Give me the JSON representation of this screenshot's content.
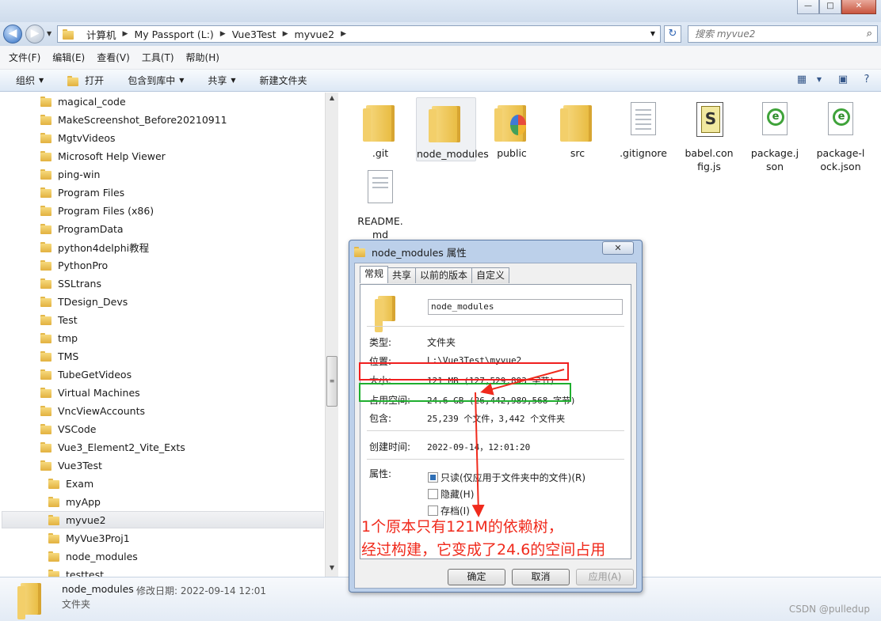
{
  "window": {
    "minimize_glyph": "—",
    "maximize_glyph": "□",
    "close_glyph": "✕"
  },
  "address": {
    "crumbs": [
      "计算机",
      "My Passport (L:)",
      "Vue3Test",
      "myvue2"
    ],
    "search_placeholder": "搜索 myvue2"
  },
  "menu": {
    "items": [
      "文件(F)",
      "编辑(E)",
      "查看(V)",
      "工具(T)",
      "帮助(H)"
    ]
  },
  "toolbar": {
    "organize": "组织",
    "open": "打开",
    "include_library": "包含到库中",
    "share": "共享",
    "new_folder": "新建文件夹"
  },
  "tree": {
    "items": [
      "magical_code",
      "MakeScreenshot_Before20210911",
      "MgtvVideos",
      "Microsoft Help Viewer",
      "ping-win",
      "Program Files",
      "Program Files (x86)",
      "ProgramData",
      "python4delphi教程",
      "PythonPro",
      "SSLtrans",
      "TDesign_Devs",
      "Test",
      "tmp",
      "TMS",
      "TubeGetVideos",
      "Virtual Machines",
      "VncViewAccounts",
      "VSCode",
      "Vue3_Element2_Vite_Exts",
      "Vue3Test"
    ],
    "children": [
      "Exam",
      "myApp",
      "myvue2",
      "MyVue3Proj1",
      "node_modules",
      "testtest"
    ],
    "selected": "myvue2"
  },
  "files": {
    "items": [
      {
        "name": ".git",
        "kind": "folder"
      },
      {
        "name": "node_modules",
        "kind": "folder"
      },
      {
        "name": "public",
        "kind": "folder"
      },
      {
        "name": "src",
        "kind": "folder"
      },
      {
        "name": ".gitignore",
        "kind": "document"
      },
      {
        "name": "babel.config.js",
        "kind": "script"
      },
      {
        "name": "package.json",
        "kind": "web-document"
      },
      {
        "name": "package-lock.json",
        "kind": "web-document"
      },
      {
        "name": "README.md",
        "kind": "document"
      }
    ]
  },
  "status": {
    "name": "node_modules",
    "date_label": "修改日期:",
    "date": "2022-09-14 12:01",
    "type": "文件夹",
    "watermark": "CSDN @pulledup"
  },
  "dialog": {
    "title": "node_modules 属性",
    "tabs": [
      "常规",
      "共享",
      "以前的版本",
      "自定义"
    ],
    "active_tab": "常规",
    "folder_name": "node_modules",
    "type_label": "类型:",
    "type_value": "文件夹",
    "location_label": "位置:",
    "location_value": "L:\\Vue3Test\\myvue2",
    "size_label": "大小:",
    "size_value": "121 MB (127,529,893 字节)",
    "disk_label": "占用空间:",
    "disk_value": "24.6 GB (26,442,989,568 字节)",
    "contains_label": "包含:",
    "contains_value": "25,239 个文件，3,442 个文件夹",
    "created_label": "创建时间:",
    "created_value": "2022-09-14，12:01:20",
    "attr_label": "属性:",
    "attrs": [
      {
        "label": "只读(仅应用于文件夹中的文件)(R)",
        "checked": true
      },
      {
        "label": "隐藏(H)",
        "checked": false
      },
      {
        "label": "存档(I)",
        "checked": false
      }
    ],
    "ok": "确定",
    "cancel": "取消",
    "apply": "应用(A)"
  },
  "annotation": {
    "line1": "1个原本只有121M的依赖树，",
    "line2": "经过构建，它变成了24.6的空间占用",
    "red": "#f01f1f",
    "green": "#1fae2f"
  }
}
